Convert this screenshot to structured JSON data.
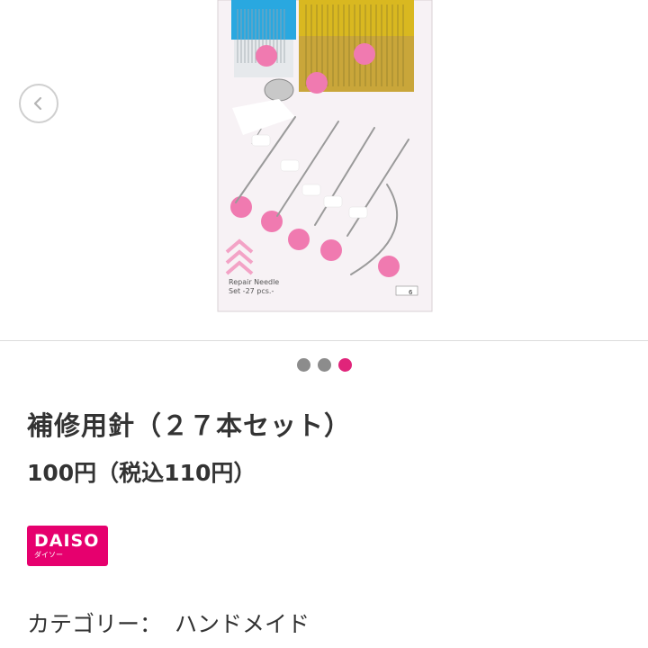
{
  "product": {
    "title": "補修用針（２７本セット）",
    "price": "100円（税込110円）"
  },
  "brand": {
    "logo_text": "DAISO",
    "logo_subtext": "ダイソー",
    "color": "#e6006e"
  },
  "category": {
    "label": "カテゴリー：",
    "value": "ハンドメイド"
  },
  "carousel": {
    "total_slides": 3,
    "active_slide": 3,
    "active_color": "#e0247a",
    "inactive_color": "#8c8c8c",
    "prev_icon": "chevron-left-icon"
  },
  "package": {
    "name_en": "Repair Needle",
    "count_en": "Set -27 pcs.-",
    "label_code": "6"
  }
}
